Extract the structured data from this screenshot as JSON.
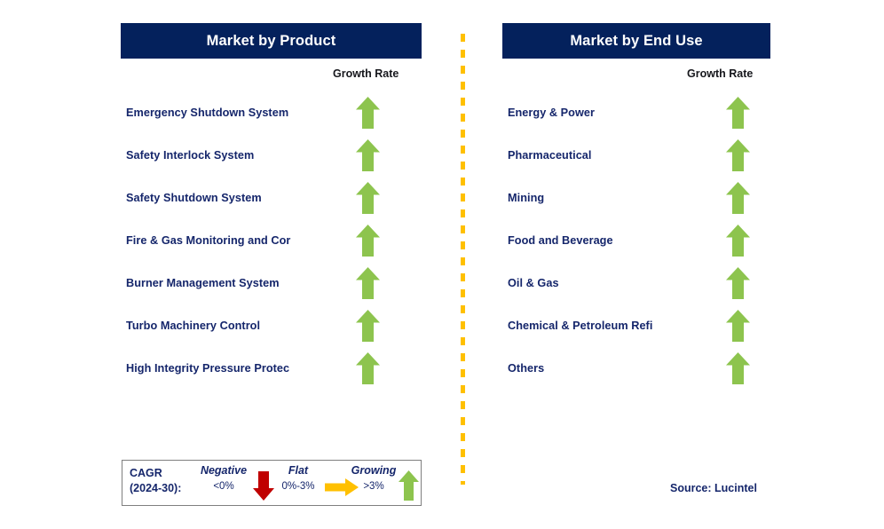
{
  "panels": [
    {
      "id": "product",
      "title": "Market by Product",
      "growth_rate_label": "Growth Rate",
      "rows": [
        {
          "label": "Emergency Shutdown System",
          "trend": "growing",
          "icon": "arrow-up-icon"
        },
        {
          "label": "Safety Interlock System",
          "trend": "growing",
          "icon": "arrow-up-icon"
        },
        {
          "label": "Safety Shutdown System",
          "trend": "growing",
          "icon": "arrow-up-icon"
        },
        {
          "label": "Fire & Gas Monitoring and Cor",
          "trend": "growing",
          "icon": "arrow-up-icon"
        },
        {
          "label": "Burner Management System",
          "trend": "growing",
          "icon": "arrow-up-icon"
        },
        {
          "label": "Turbo Machinery Control",
          "trend": "growing",
          "icon": "arrow-up-icon"
        },
        {
          "label": "High Integrity Pressure Protec",
          "trend": "growing",
          "icon": "arrow-up-icon"
        }
      ]
    },
    {
      "id": "enduse",
      "title": "Market by End Use",
      "growth_rate_label": "Growth Rate",
      "rows": [
        {
          "label": "Energy & Power",
          "trend": "growing",
          "icon": "arrow-up-icon"
        },
        {
          "label": "Pharmaceutical",
          "trend": "growing",
          "icon": "arrow-up-icon"
        },
        {
          "label": "Mining",
          "trend": "growing",
          "icon": "arrow-up-icon"
        },
        {
          "label": "Food and Beverage",
          "trend": "growing",
          "icon": "arrow-up-icon"
        },
        {
          "label": "Oil & Gas",
          "trend": "growing",
          "icon": "arrow-up-icon"
        },
        {
          "label": "Chemical & Petroleum Refi",
          "trend": "growing",
          "icon": "arrow-up-icon"
        },
        {
          "label": "Others",
          "trend": "growing",
          "icon": "arrow-up-icon"
        }
      ]
    }
  ],
  "legend": {
    "cagr_line1": "CAGR",
    "cagr_line2": "(2024-30):",
    "items": [
      {
        "title": "Negative",
        "value": "<0%",
        "icon": "arrow-down-icon",
        "color": "#c00000"
      },
      {
        "title": "Flat",
        "value": "0%-3%",
        "icon": "arrow-right-icon",
        "color": "#ffc000"
      },
      {
        "title": "Growing",
        "value": ">3%",
        "icon": "arrow-up-icon",
        "color": "#8dc44e"
      }
    ]
  },
  "source": "Source: Lucintel",
  "colors": {
    "header_bg": "#04215c",
    "header_text": "#ffffff",
    "label_text": "#15266b",
    "arrow_green": "#8dc44e",
    "arrow_red": "#c00000",
    "arrow_amber": "#ffc000",
    "divider": "#ffc000",
    "legend_border": "#7f7f7f"
  },
  "chart_data": {
    "type": "table",
    "title": "Market Segments Growth Rate Outlook",
    "legend_position": "bottom-left",
    "series": [
      {
        "name": "Market by Product",
        "categories": [
          "Emergency Shutdown System",
          "Safety Interlock System",
          "Safety Shutdown System",
          "Fire & Gas Monitoring and Cor",
          "Burner Management System",
          "Turbo Machinery Control",
          "High Integrity Pressure Protec"
        ],
        "values": [
          "growing",
          "growing",
          "growing",
          "growing",
          "growing",
          "growing",
          "growing"
        ]
      },
      {
        "name": "Market by End Use",
        "categories": [
          "Energy & Power",
          "Pharmaceutical",
          "Mining",
          "Food and Beverage",
          "Oil & Gas",
          "Chemical & Petroleum Refi",
          "Others"
        ],
        "values": [
          "growing",
          "growing",
          "growing",
          "growing",
          "growing",
          "growing",
          "growing"
        ]
      }
    ],
    "legend_entries": [
      {
        "label": "Negative",
        "range": "<0%"
      },
      {
        "label": "Flat",
        "range": "0%-3%"
      },
      {
        "label": "Growing",
        "range": ">3%"
      }
    ],
    "annotations": [
      "CAGR (2024-30):",
      "Source: Lucintel"
    ]
  }
}
